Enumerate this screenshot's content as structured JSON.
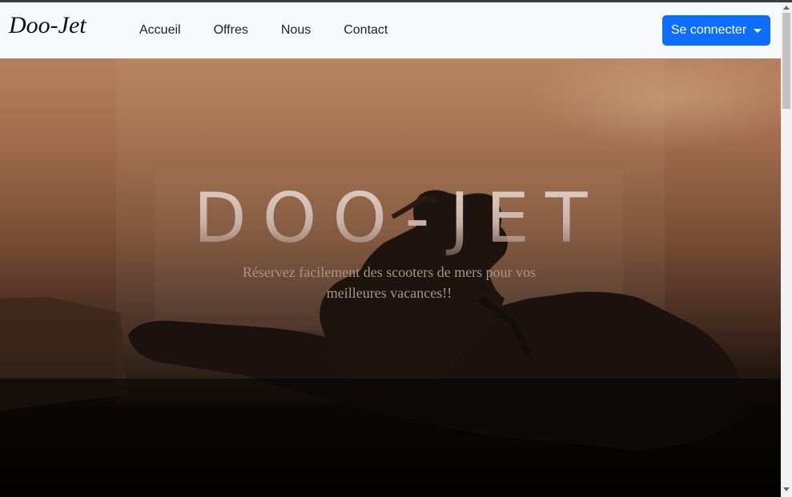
{
  "navbar": {
    "brand": "Doo-Jet",
    "links": [
      {
        "label": "Accueil"
      },
      {
        "label": "Offres"
      },
      {
        "label": "Nous"
      },
      {
        "label": "Contact"
      }
    ],
    "login_button": "Se connecter",
    "login_icon": "caret-down-icon",
    "background": "#f8f9fa",
    "button_color": "#0d6efd"
  },
  "hero": {
    "title": "DOO-JET",
    "subtitle": "Réservez facilement des scooters de mers pour vos meilleures vacances!!",
    "image": "jet-ski-rider-silhouette-at-sunset"
  }
}
